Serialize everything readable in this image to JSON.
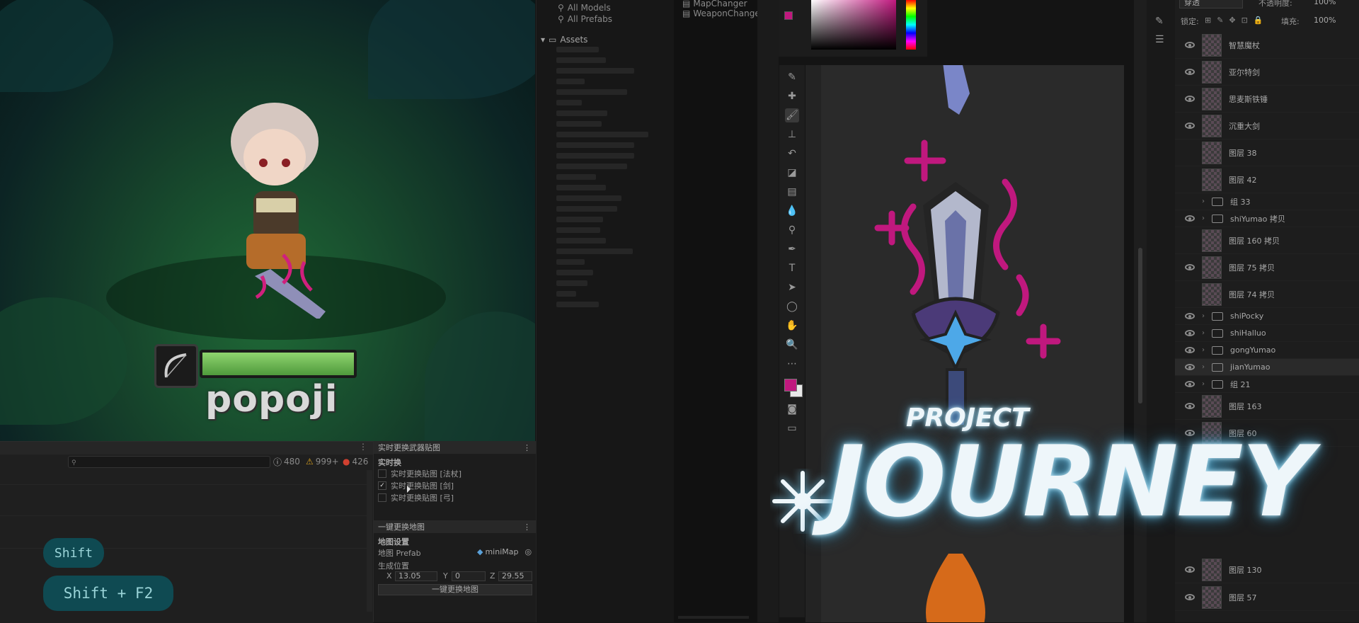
{
  "game_view": {
    "player_name": "popoji",
    "health_fraction": 1.0
  },
  "console": {
    "count_info": "480",
    "count_warn": "999+",
    "count_error": "426"
  },
  "keystrokes": [
    "Shift",
    "Shift + F2"
  ],
  "realtime_panel": {
    "tab_title": "实时更换武器贴图",
    "section_label": "实时换",
    "items": [
      {
        "label": "实时更换贴图 [法杖]",
        "checked": false
      },
      {
        "label": "实时更换贴图 [剑]",
        "checked": true
      },
      {
        "label": "实时更换贴图 [弓]",
        "checked": false
      }
    ]
  },
  "map_panel": {
    "tab_title": "一键更换地图",
    "section_label": "地图设置",
    "prefab_label": "地图 Prefab",
    "prefab_value": "miniMap",
    "position_label": "生成位置",
    "x_label": "X",
    "x_value": "13.05",
    "y_label": "Y",
    "y_value": "0",
    "z_label": "Z",
    "z_value": "29.55",
    "button_label": "一键更换地图"
  },
  "project": {
    "search_items": [
      "All Models",
      "All Prefabs"
    ],
    "root_folder": "Assets",
    "top_files": [
      "MapChanger",
      "WeaponChange"
    ]
  },
  "layers_panel": {
    "blend_mode": "穿透",
    "opacity_label": "不透明度:",
    "opacity_value": "100%",
    "lock_label": "锁定:",
    "fill_label": "填充:",
    "fill_value": "100%",
    "rows": [
      {
        "name": "智慧魔杖",
        "visible": true,
        "kind": "layer"
      },
      {
        "name": "亚尔特剑",
        "visible": true,
        "kind": "layer"
      },
      {
        "name": "思麦斯铁锤",
        "visible": true,
        "kind": "layer"
      },
      {
        "name": "沉重大剑",
        "visible": true,
        "kind": "layer"
      },
      {
        "name": "图层 38",
        "visible": false,
        "kind": "layer"
      },
      {
        "name": "图层 42",
        "visible": false,
        "kind": "layer"
      },
      {
        "name": "组 33",
        "visible": false,
        "kind": "group"
      },
      {
        "name": "shiYumao 拷贝",
        "visible": true,
        "kind": "group"
      },
      {
        "name": "图层 160 拷贝",
        "visible": false,
        "kind": "layer"
      },
      {
        "name": "图层 75 拷贝",
        "visible": true,
        "kind": "layer"
      },
      {
        "name": "图层 74 拷贝",
        "visible": false,
        "kind": "layer"
      },
      {
        "name": "shiPocky",
        "visible": true,
        "kind": "group"
      },
      {
        "name": "shiHalluo",
        "visible": true,
        "kind": "group"
      },
      {
        "name": "gongYumao",
        "visible": true,
        "kind": "group"
      },
      {
        "name": "jianYumao",
        "visible": true,
        "kind": "group"
      },
      {
        "name": "组 21",
        "visible": true,
        "kind": "group"
      },
      {
        "name": "图层 163",
        "visible": true,
        "kind": "layer"
      },
      {
        "name": "图层 60",
        "visible": true,
        "kind": "layer"
      }
    ],
    "bottom_rows": [
      {
        "name": "图层 130",
        "visible": true
      },
      {
        "name": "图层 57",
        "visible": true
      }
    ]
  },
  "logo": {
    "subtitle": "PROJECT",
    "title": "JOURNEY"
  },
  "colors": {
    "accent_magenta": "#c0187e",
    "key_bg": "#0f4a52",
    "logo_glow": "#6fb9d8"
  }
}
